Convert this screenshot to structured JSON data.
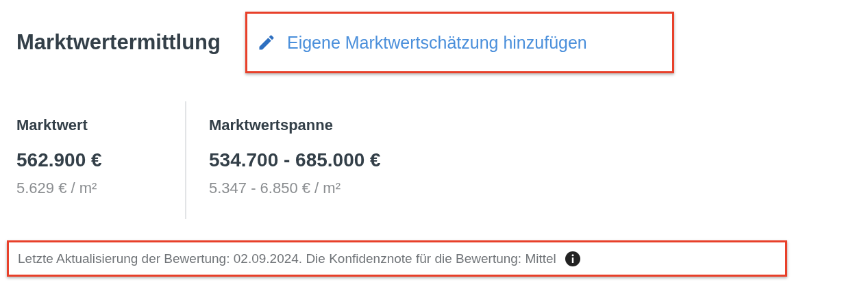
{
  "title": "Marktwertermittlung",
  "action_link": {
    "label": "Eigene Marktwertschätzung hinzufügen",
    "highlighted": true
  },
  "stats": [
    {
      "label": "Marktwert",
      "value": "562.900 €",
      "per_area": "5.629 € / m²"
    },
    {
      "label": "Marktwertspanne",
      "value": "534.700 - 685.000 €",
      "per_area": "5.347 - 6.850 € / m²"
    }
  ],
  "footer": {
    "text": "Letzte Aktualisierung der Bewertung: 02.09.2024. Die Konfidenznote für die Bewertung: Mittel",
    "highlighted": true
  }
}
